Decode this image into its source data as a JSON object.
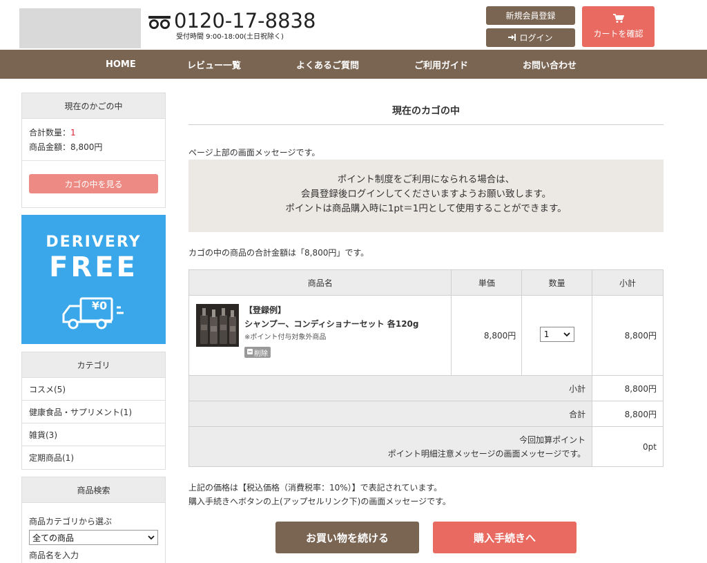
{
  "header": {
    "phone": "0120-17-8838",
    "hours": "受付時間 9:00-18:00(土日祝除く)",
    "register_label": "新規会員登録",
    "login_label": "ログイン",
    "cart_label": "カートを確認"
  },
  "nav": {
    "items": [
      {
        "label": "HOME"
      },
      {
        "label": "レビュー一覧"
      },
      {
        "label": "よくあるご質問"
      },
      {
        "label": "ご利用ガイド"
      },
      {
        "label": "お問い合わせ"
      }
    ]
  },
  "sidebar": {
    "cart_box": {
      "title": "現在のかごの中",
      "qty_label": "合計数量：",
      "qty_value": "1",
      "amount_line": "商品金額：8,800円",
      "view_button": "カゴの中を見る"
    },
    "banner": {
      "line1": "DERIVERY",
      "line2": "FREE",
      "price_tag": "¥0"
    },
    "category": {
      "title": "カテゴリ",
      "items": [
        {
          "label": "コスメ(5)"
        },
        {
          "label": "健康食品・サプリメント(1)"
        },
        {
          "label": "雑貨(3)"
        },
        {
          "label": "定期商品(1)"
        }
      ]
    },
    "search": {
      "title": "商品検索",
      "category_label": "商品カテゴリから選ぶ",
      "category_value": "全ての商品",
      "name_label": "商品名を入力"
    }
  },
  "main": {
    "title": "現在のカゴの中",
    "top_message": "ページ上部の画面メッセージです。",
    "point_lines": [
      "ポイント制度をご利用になられる場合は、",
      "会員登録後ログインしてくださいますようお願い致します。",
      "ポイントは商品購入時に1pt＝1円として使用することができます。"
    ],
    "total_message": "カゴの中の商品の合計金額は「8,800円」です。",
    "table": {
      "headers": {
        "product": "商品名",
        "price": "単価",
        "qty": "数量",
        "subtotal": "小計"
      },
      "row": {
        "tag": "【登録例】",
        "name": "シャンプー、コンディショナーセット 各120g",
        "note": "※ポイント付与対象外商品",
        "delete_label": "削除",
        "price": "8,800円",
        "qty": "1",
        "subtotal": "8,800円"
      },
      "summary": {
        "subtotal_label": "小計",
        "subtotal_value": "8,800円",
        "total_label": "合計",
        "total_value": "8,800円",
        "point_label": "今回加算ポイント",
        "point_note": "ポイント明細注意メッセージの画面メッセージです。",
        "point_value": "0pt"
      }
    },
    "tax_message": "上記の価格は【税込価格（消費税率：10%）】で表記されています。",
    "upsell_message": "購入手続きへボタンの上(アップセルリンク下)の画面メッセージです。",
    "continue_button": "お買い物を続ける",
    "checkout_button": "購入手続きへ"
  },
  "colors": {
    "brown": "#7a6553",
    "coral": "#e86a60",
    "banner_blue": "#3aa7ea",
    "red_text": "#e0222f"
  }
}
